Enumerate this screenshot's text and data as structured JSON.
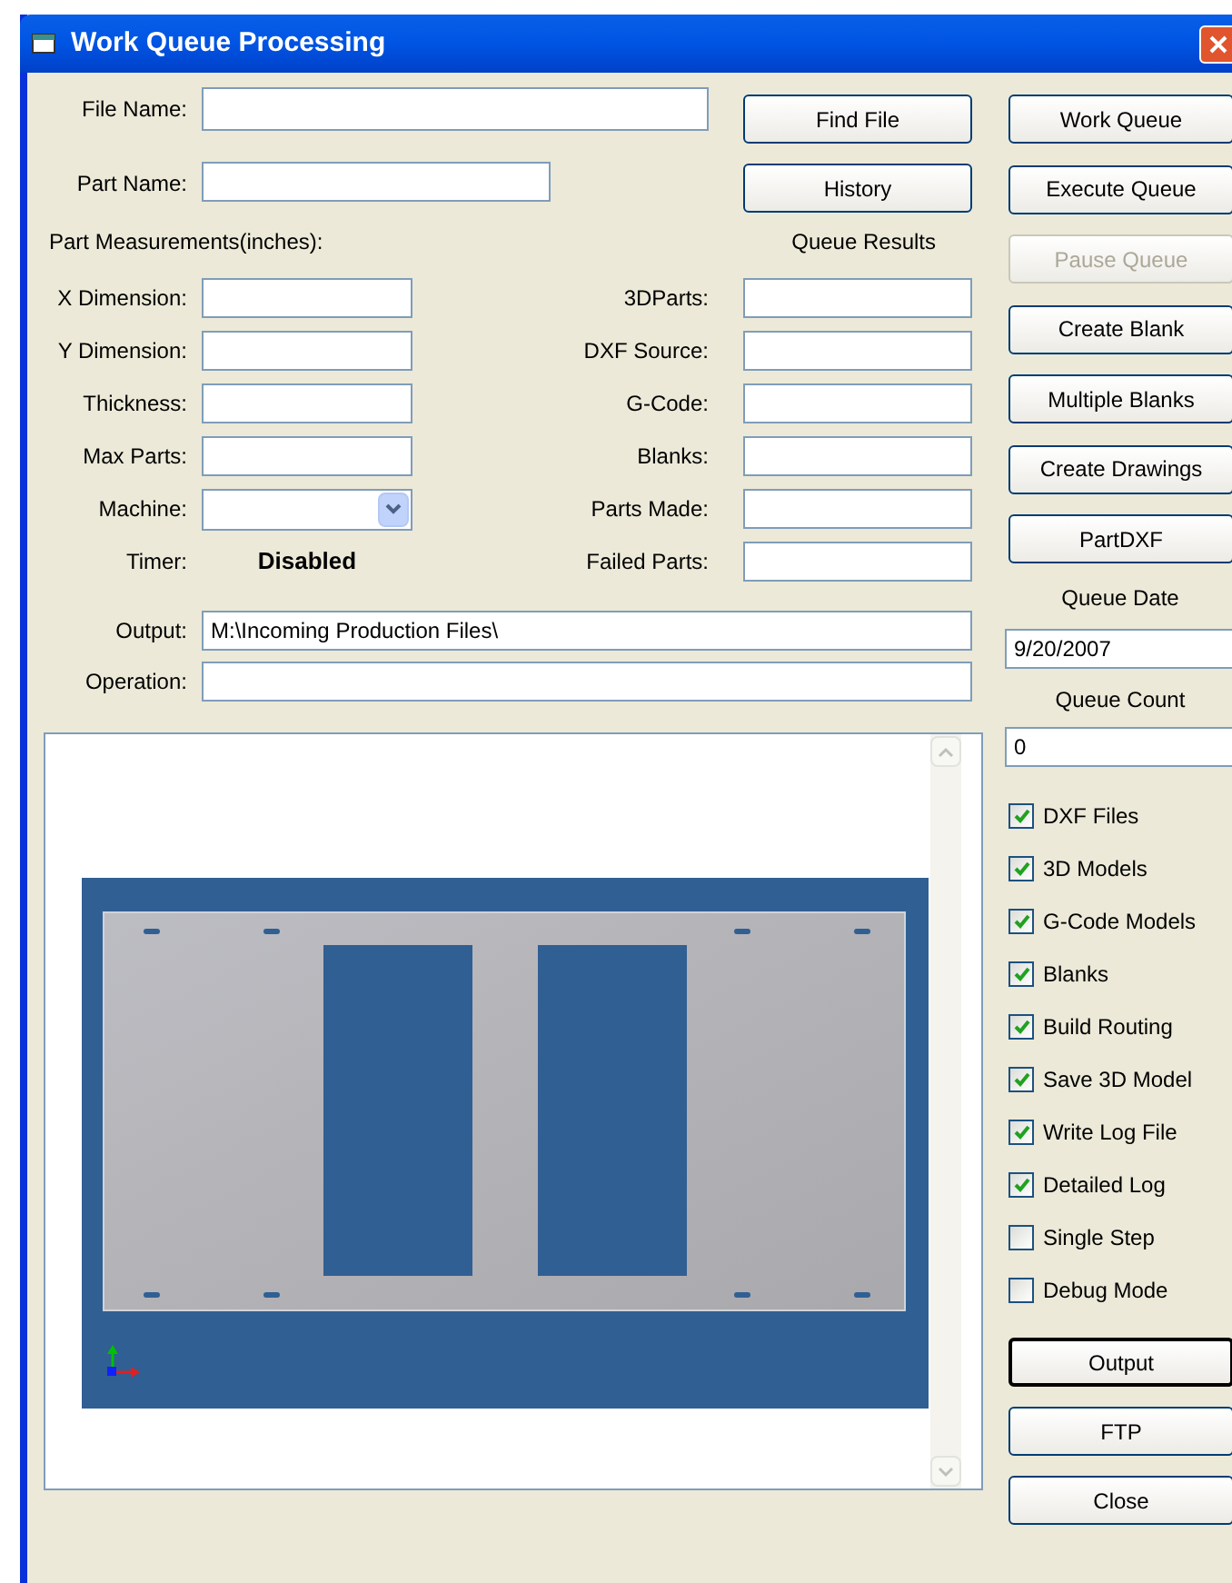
{
  "window": {
    "title": "Work Queue Processing"
  },
  "file_name": {
    "label": "File Name:"
  },
  "part_name": {
    "label": "Part Name:"
  },
  "file_buttons": [
    "Find File",
    "History"
  ],
  "measurements": {
    "heading": "Part Measurements(inches):",
    "fields": [
      {
        "label": "X Dimension:",
        "kind": "text"
      },
      {
        "label": "Y Dimension:",
        "kind": "text"
      },
      {
        "label": "Thickness:",
        "kind": "text"
      },
      {
        "label": "Max Parts:",
        "kind": "text"
      },
      {
        "label": "Machine:",
        "kind": "dropdown"
      },
      {
        "label": "Timer:",
        "kind": "status",
        "value": "Disabled"
      }
    ]
  },
  "queue_results": {
    "heading": "Queue Results",
    "fields": [
      "3DParts:",
      "DXF Source:",
      "G-Code:",
      "Blanks:",
      "Parts Made:",
      "Failed Parts:"
    ]
  },
  "output": {
    "label": "Output:",
    "value": "M:\\Incoming Production Files\\"
  },
  "operation": {
    "label": "Operation:"
  },
  "side_buttons": [
    {
      "label": "Work Queue",
      "disabled": false
    },
    {
      "label": "Execute Queue",
      "disabled": false
    },
    {
      "label": "Pause Queue",
      "disabled": true
    },
    {
      "label": "Create Blank",
      "disabled": false
    },
    {
      "label": "Multiple Blanks",
      "disabled": false
    },
    {
      "label": "Create Drawings",
      "disabled": false
    },
    {
      "label": "PartDXF",
      "disabled": false
    }
  ],
  "queue_date": {
    "label": "Queue Date",
    "value": "9/20/2007"
  },
  "queue_count": {
    "label": "Queue Count",
    "value": "0"
  },
  "options": [
    {
      "label": "DXF Files",
      "checked": true
    },
    {
      "label": "3D Models",
      "checked": true
    },
    {
      "label": "G-Code Models",
      "checked": true
    },
    {
      "label": "Blanks",
      "checked": true
    },
    {
      "label": "Build Routing",
      "checked": true
    },
    {
      "label": "Save 3D Model",
      "checked": true
    },
    {
      "label": "Write Log File",
      "checked": true
    },
    {
      "label": "Detailed Log",
      "checked": true
    },
    {
      "label": "Single Step",
      "checked": false
    },
    {
      "label": "Debug Mode",
      "checked": false
    }
  ],
  "bottom_buttons": [
    {
      "label": "Output",
      "default": true
    },
    {
      "label": "FTP",
      "default": false
    },
    {
      "label": "Close",
      "default": false
    }
  ]
}
